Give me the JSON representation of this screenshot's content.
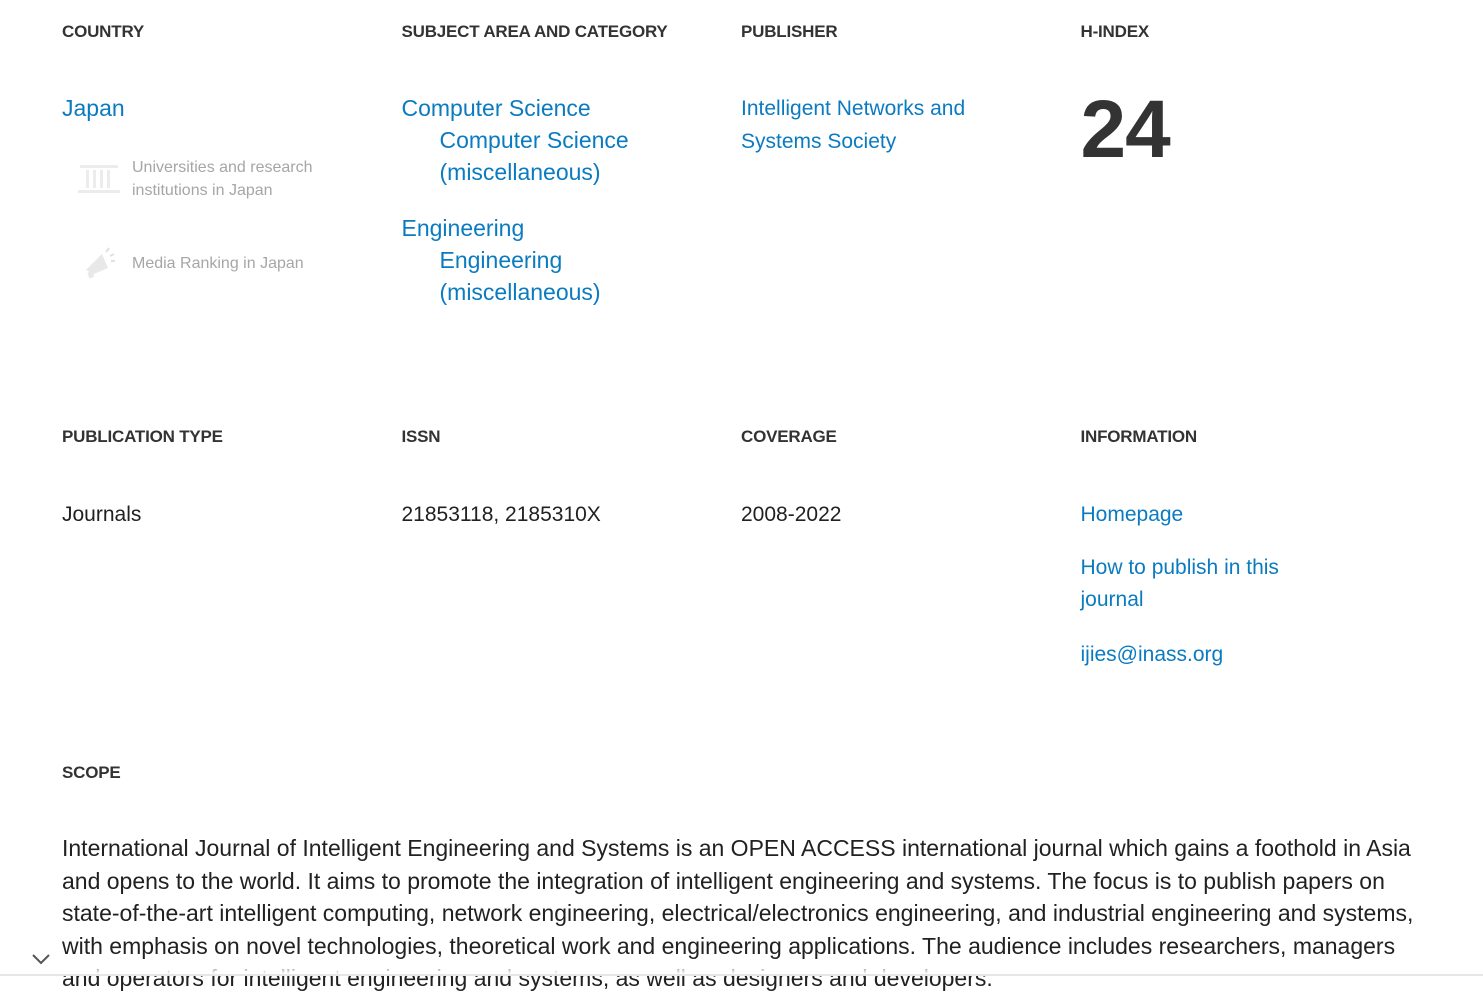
{
  "row1": {
    "country": {
      "header": "COUNTRY",
      "value": "Japan",
      "links": [
        {
          "label": "Universities and research institutions in Japan",
          "icon": "institution-icon"
        },
        {
          "label": "Media Ranking in Japan",
          "icon": "megaphone-icon"
        }
      ]
    },
    "subject": {
      "header": "SUBJECT AREA AND CATEGORY",
      "areas": [
        {
          "area": "Computer Science",
          "category": "Computer Science (miscellaneous)"
        },
        {
          "area": "Engineering",
          "category": "Engineering (miscellaneous)"
        }
      ]
    },
    "publisher": {
      "header": "PUBLISHER",
      "value": "Intelligent Networks and Systems Society"
    },
    "hindex": {
      "header": "H-INDEX",
      "value": "24"
    }
  },
  "row2": {
    "publication_type": {
      "header": "PUBLICATION TYPE",
      "value": "Journals"
    },
    "issn": {
      "header": "ISSN",
      "value": "21853118, 2185310X"
    },
    "coverage": {
      "header": "COVERAGE",
      "value": "2008-2022"
    },
    "information": {
      "header": "INFORMATION",
      "homepage": "Homepage",
      "how_to_publish": "How to publish in this journal",
      "email": "ijies@inass.org"
    }
  },
  "scope": {
    "header": "SCOPE",
    "text": "International Journal of Intelligent Engineering and Systems is an OPEN ACCESS international journal which gains a foothold in Asia and opens to the world. It aims to promote the integration of intelligent engineering and systems. The focus is to publish papers on state-of-the-art intelligent computing, network engineering, electrical/electronics engineering, and industrial engineering and systems, with emphasis on novel technologies, theoretical work and engineering applications. The audience includes researchers, managers and operators for intelligent engineering and systems, as well as designers and developers."
  },
  "colors": {
    "link": "#0b7bc1",
    "header": "#333333",
    "muted": "#a6a6a6"
  }
}
